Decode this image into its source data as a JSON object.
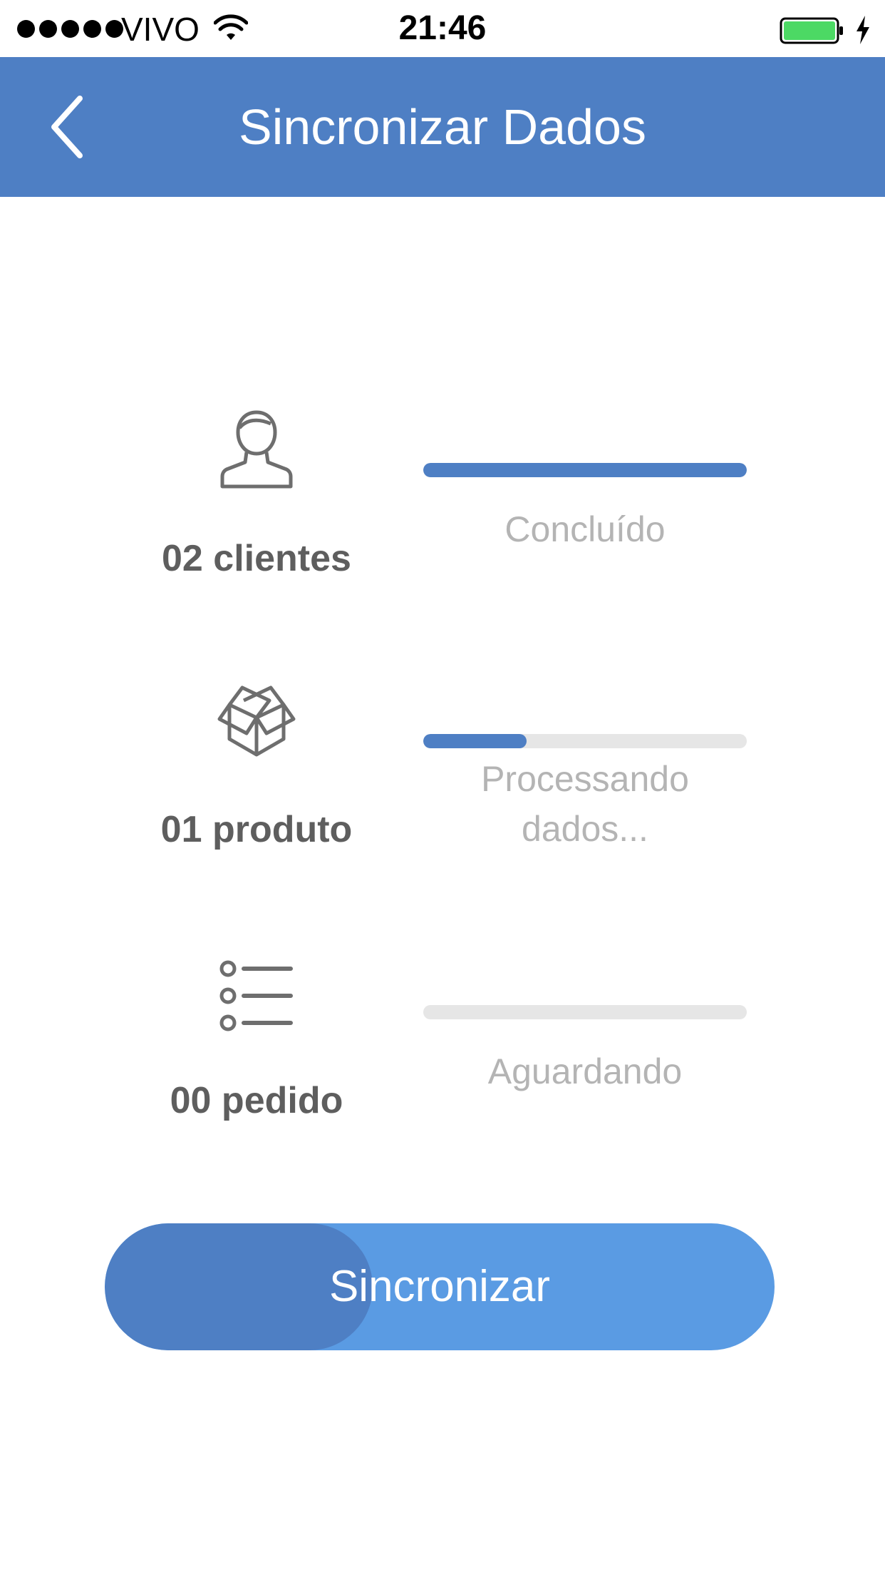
{
  "status_bar": {
    "carrier": "VIVO",
    "time": "21:46",
    "signal_bars": 5,
    "battery_color": "#4cd964"
  },
  "nav": {
    "title": "Sincronizar Dados",
    "background": "#4e7fc4",
    "back_icon": "chevron-left-icon"
  },
  "rows": [
    {
      "icon": "user-icon",
      "count_label": "02 clientes",
      "status": "Concluído",
      "progress": 1.0
    },
    {
      "icon": "box-icon",
      "count_label": "01 produto",
      "status": "Processando dados...",
      "progress": 0.32
    },
    {
      "icon": "list-icon",
      "count_label": "00 pedido",
      "status": "Aguardando",
      "progress": 0.0
    }
  ],
  "sync_button": {
    "label": "Sincronizar",
    "progress": 0.4,
    "color": "#5a9be3",
    "progress_color": "#4e7fc4"
  }
}
